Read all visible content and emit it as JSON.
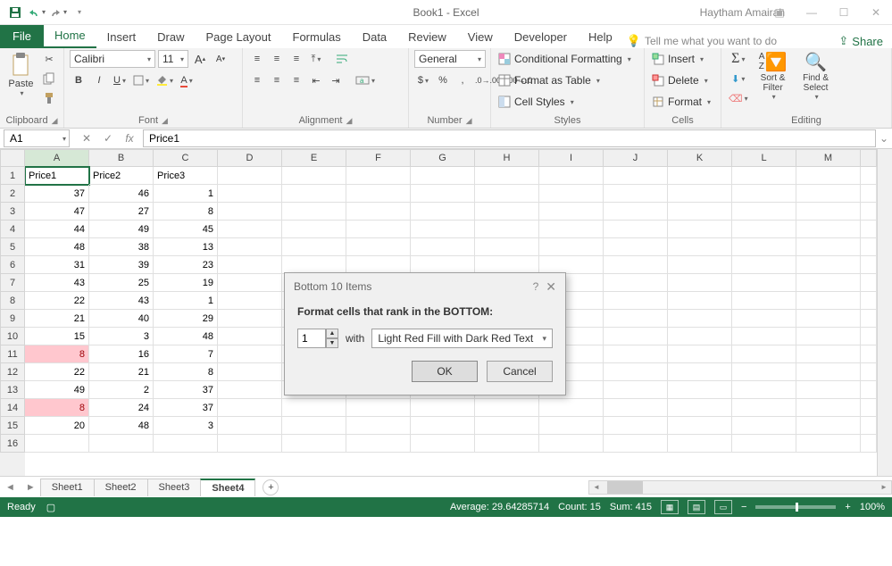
{
  "title": {
    "doc": "Book1",
    "sep": "  -  ",
    "app": "Excel",
    "user": "Haytham Amairah"
  },
  "tabs": {
    "file": "File",
    "items": [
      "Home",
      "Insert",
      "Draw",
      "Page Layout",
      "Formulas",
      "Data",
      "Review",
      "View",
      "Developer",
      "Help"
    ],
    "active": 0,
    "tellme": "Tell me what you want to do",
    "share": "Share"
  },
  "ribbon": {
    "clipboard": {
      "paste": "Paste",
      "label": "Clipboard"
    },
    "font": {
      "name": "Calibri",
      "size": "11",
      "label": "Font"
    },
    "alignment": {
      "label": "Alignment"
    },
    "number": {
      "format": "General",
      "label": "Number"
    },
    "styles": {
      "cf": "Conditional Formatting",
      "ft": "Format as Table",
      "cs": "Cell Styles",
      "label": "Styles"
    },
    "cells": {
      "insert": "Insert",
      "delete": "Delete",
      "format": "Format",
      "label": "Cells"
    },
    "editing": {
      "sort": "Sort &",
      "filter": "Filter",
      "find": "Find &",
      "select": "Select",
      "label": "Editing"
    }
  },
  "fx": {
    "name": "A1",
    "formula": "Price1"
  },
  "grid": {
    "cols": [
      "A",
      "B",
      "C",
      "D",
      "E",
      "F",
      "G",
      "H",
      "I",
      "J",
      "K",
      "L",
      "M"
    ],
    "headers": [
      "Price1",
      "Price2",
      "Price3"
    ],
    "rows": [
      [
        37,
        46,
        1
      ],
      [
        47,
        27,
        8
      ],
      [
        44,
        49,
        45
      ],
      [
        48,
        38,
        13
      ],
      [
        31,
        39,
        23
      ],
      [
        43,
        25,
        19
      ],
      [
        22,
        43,
        1
      ],
      [
        21,
        40,
        29
      ],
      [
        15,
        3,
        48
      ],
      [
        8,
        16,
        7
      ],
      [
        22,
        21,
        8
      ],
      [
        49,
        2,
        37
      ],
      [
        8,
        24,
        37
      ],
      [
        20,
        48,
        3
      ]
    ],
    "highlight": {
      "col": 0,
      "rows": [
        9,
        12
      ]
    }
  },
  "sheets": {
    "items": [
      "Sheet1",
      "Sheet2",
      "Sheet3",
      "Sheet4"
    ],
    "active": 3
  },
  "dialog": {
    "title": "Bottom 10 Items",
    "label": "Format cells that rank in the BOTTOM:",
    "value": "1",
    "with": "with",
    "option": "Light Red Fill with Dark Red Text",
    "ok": "OK",
    "cancel": "Cancel"
  },
  "status": {
    "ready": "Ready",
    "avg_lbl": "Average:",
    "avg": "29.64285714",
    "count_lbl": "Count:",
    "count": "15",
    "sum_lbl": "Sum:",
    "sum": "415",
    "zoom": "100%"
  }
}
